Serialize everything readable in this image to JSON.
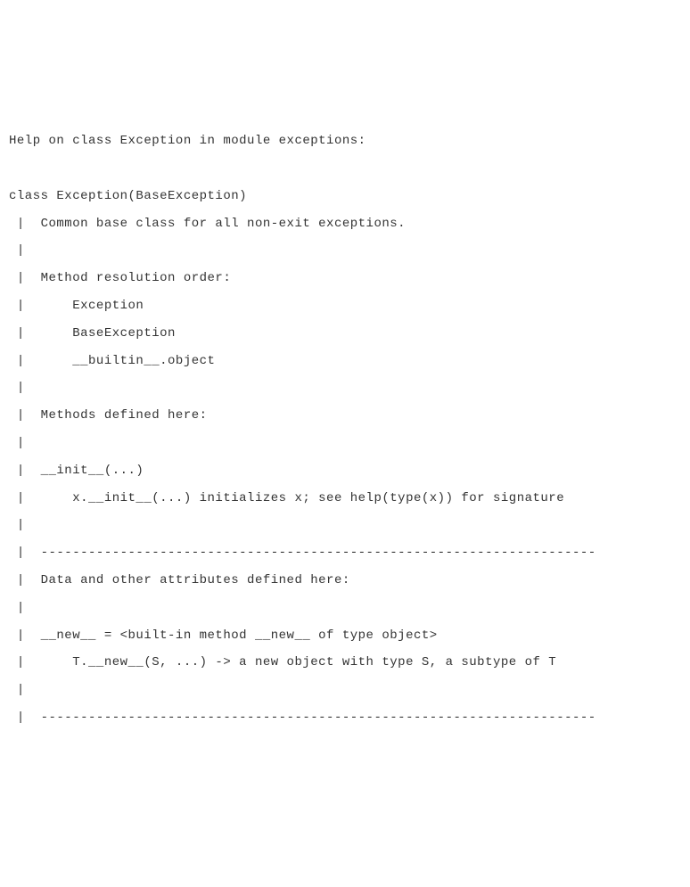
{
  "help": {
    "header": "Help on class Exception in module exceptions:",
    "blank1": "",
    "class_line": "class Exception(BaseException)",
    "docstring": " |  Common base class for all non-exit exceptions.",
    "pipe1": " |",
    "mro_header": " |  Method resolution order:",
    "mro1": " |      Exception",
    "mro2": " |      BaseException",
    "mro3": " |      __builtin__.object",
    "pipe2": " |",
    "methods_header": " |  Methods defined here:",
    "pipe3": " |",
    "init_sig": " |  __init__(...)",
    "init_desc": " |      x.__init__(...) initializes x; see help(type(x)) for signature",
    "pipe4": " |",
    "divider1": " |  ----------------------------------------------------------------------",
    "data_header": " |  Data and other attributes defined here:",
    "pipe5": " |",
    "new_sig": " |  __new__ = <built-in method __new__ of type object>",
    "new_desc": " |      T.__new__(S, ...) -> a new object with type S, a subtype of T",
    "pipe6": " |",
    "divider2": " |  ----------------------------------------------------------------------"
  }
}
